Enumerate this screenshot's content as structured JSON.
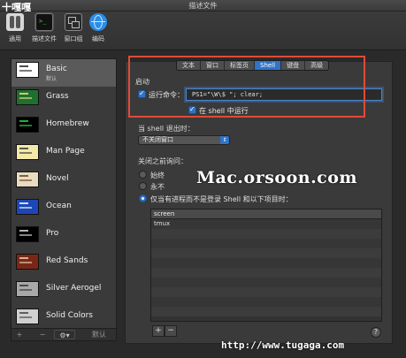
{
  "window": {
    "title": "描述文件"
  },
  "watermarks": {
    "top_left": "十嘎嘎",
    "center": "Mac.orsoon.com",
    "bottom": "http://www.tugaga.com"
  },
  "toolbar": {
    "items": [
      {
        "label": "通用",
        "icon": "switch-icon"
      },
      {
        "label": "描述文件",
        "icon": "terminal-icon"
      },
      {
        "label": "窗口组",
        "icon": "window-group-icon"
      },
      {
        "label": "编码",
        "icon": "globe-icon"
      }
    ]
  },
  "profiles": [
    {
      "name": "Basic",
      "sub": "默认",
      "bg": "#ffffff",
      "fg": "#222222",
      "selected": true
    },
    {
      "name": "Grass",
      "sub": "",
      "bg": "#1f6f2e",
      "fg": "#f5e08a"
    },
    {
      "name": "Homebrew",
      "sub": "",
      "bg": "#000000",
      "fg": "#2bd94a"
    },
    {
      "name": "Man Page",
      "sub": "",
      "bg": "#f3e9a8",
      "fg": "#333333"
    },
    {
      "name": "Novel",
      "sub": "",
      "bg": "#e8dcc0",
      "fg": "#6b3d22"
    },
    {
      "name": "Ocean",
      "sub": "",
      "bg": "#1d47b8",
      "fg": "#ffffff"
    },
    {
      "name": "Pro",
      "sub": "",
      "bg": "#000000",
      "fg": "#e0e0e0"
    },
    {
      "name": "Red Sands",
      "sub": "",
      "bg": "#7a2718",
      "fg": "#e8d7b0"
    },
    {
      "name": "Silver Aerogel",
      "sub": "",
      "bg": "#a8a8a8",
      "fg": "#333333"
    },
    {
      "name": "Solid Colors",
      "sub": "",
      "bg": "#d0d0d0",
      "fg": "#444444"
    }
  ],
  "sidebar_footer": {
    "add": "+",
    "remove": "−",
    "gear": "⚙▾",
    "default": "默认"
  },
  "tabs": [
    {
      "label": "文本"
    },
    {
      "label": "窗口"
    },
    {
      "label": "标签页"
    },
    {
      "label": "Shell",
      "active": true
    },
    {
      "label": "键盘"
    },
    {
      "label": "高级"
    }
  ],
  "startup": {
    "section_label": "启动",
    "run_command_label": "运行命令：",
    "run_command_checked": true,
    "command_value": "PS1=\"\\W\\$ \"; clear;",
    "run_in_shell_label": "在 shell 中运行",
    "run_in_shell_checked": true
  },
  "on_exit": {
    "label": "当 shell 退出时：",
    "selected": "不关闭窗口"
  },
  "ask_before_close": {
    "label": "关闭之前询问：",
    "options": [
      {
        "label": "始终",
        "checked": false
      },
      {
        "label": "永不",
        "checked": false
      },
      {
        "label": "仅当有进程而不是登录 Shell 和以下项目时：",
        "checked": true
      }
    ]
  },
  "process_table": {
    "rows": [
      "screen",
      "tmux",
      "",
      "",
      "",
      "",
      "",
      "",
      "",
      "",
      ""
    ]
  },
  "table_buttons": {
    "add": "+",
    "remove": "−"
  },
  "help": "?"
}
